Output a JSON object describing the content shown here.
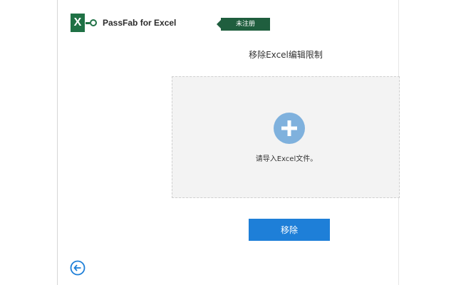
{
  "app": {
    "logo_letter": "X",
    "name": "PassFab for Excel",
    "registration_badge": "未注册"
  },
  "main": {
    "title": "移除Excel编辑限制",
    "dropzone_hint": "请导入Excel文件。",
    "remove_button_label": "移除"
  },
  "icons": {
    "add": "plus-circle-icon",
    "back": "back-arrow-icon"
  },
  "colors": {
    "brand_green": "#1f7145",
    "badge_green": "#1f5e3e",
    "add_button": "#7fb1dd",
    "primary_button": "#1e7fd8"
  }
}
